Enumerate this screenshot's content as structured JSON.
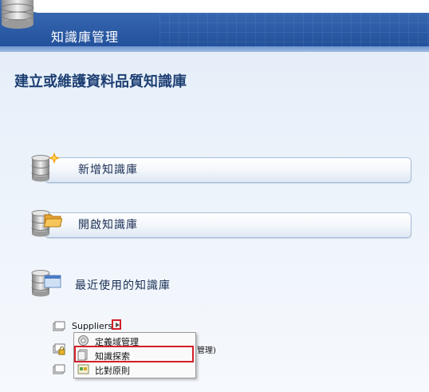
{
  "header": {
    "title": "知識庫管理"
  },
  "main": {
    "heading": "建立或維護資料品質知識庫"
  },
  "actions": [
    {
      "label": "新增知識庫",
      "icon": "database-new-icon"
    },
    {
      "label": "開啟知識庫",
      "icon": "database-open-icon"
    }
  ],
  "recent": {
    "label": "最近使用的知識庫",
    "items": [
      {
        "label": "Suppliers",
        "icon": "kb-icon"
      },
      {
        "label": "",
        "icon": "kb-locked-icon"
      },
      {
        "label": "",
        "icon": "kb-icon"
      }
    ]
  },
  "context_menu": {
    "items": [
      {
        "label": "定義域管理",
        "icon": "domain-management-icon"
      },
      {
        "label": "知識探索",
        "icon": "knowledge-discovery-icon"
      },
      {
        "label": "比對原則",
        "icon": "matching-policy-icon"
      }
    ],
    "trailing_text": "管理)"
  },
  "colors": {
    "header_blue": "#2f5ea8",
    "highlight_red": "#d3202a"
  }
}
